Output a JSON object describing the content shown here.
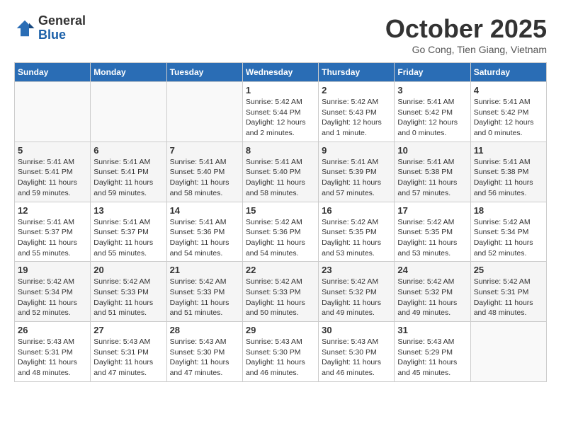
{
  "header": {
    "logo": {
      "general": "General",
      "blue": "Blue"
    },
    "title": "October 2025",
    "location": "Go Cong, Tien Giang, Vietnam"
  },
  "days_of_week": [
    "Sunday",
    "Monday",
    "Tuesday",
    "Wednesday",
    "Thursday",
    "Friday",
    "Saturday"
  ],
  "weeks": [
    [
      {
        "day": "",
        "info": ""
      },
      {
        "day": "",
        "info": ""
      },
      {
        "day": "",
        "info": ""
      },
      {
        "day": "1",
        "info": "Sunrise: 5:42 AM\nSunset: 5:44 PM\nDaylight: 12 hours\nand 2 minutes."
      },
      {
        "day": "2",
        "info": "Sunrise: 5:42 AM\nSunset: 5:43 PM\nDaylight: 12 hours\nand 1 minute."
      },
      {
        "day": "3",
        "info": "Sunrise: 5:41 AM\nSunset: 5:42 PM\nDaylight: 12 hours\nand 0 minutes."
      },
      {
        "day": "4",
        "info": "Sunrise: 5:41 AM\nSunset: 5:42 PM\nDaylight: 12 hours\nand 0 minutes."
      }
    ],
    [
      {
        "day": "5",
        "info": "Sunrise: 5:41 AM\nSunset: 5:41 PM\nDaylight: 11 hours\nand 59 minutes."
      },
      {
        "day": "6",
        "info": "Sunrise: 5:41 AM\nSunset: 5:41 PM\nDaylight: 11 hours\nand 59 minutes."
      },
      {
        "day": "7",
        "info": "Sunrise: 5:41 AM\nSunset: 5:40 PM\nDaylight: 11 hours\nand 58 minutes."
      },
      {
        "day": "8",
        "info": "Sunrise: 5:41 AM\nSunset: 5:40 PM\nDaylight: 11 hours\nand 58 minutes."
      },
      {
        "day": "9",
        "info": "Sunrise: 5:41 AM\nSunset: 5:39 PM\nDaylight: 11 hours\nand 57 minutes."
      },
      {
        "day": "10",
        "info": "Sunrise: 5:41 AM\nSunset: 5:38 PM\nDaylight: 11 hours\nand 57 minutes."
      },
      {
        "day": "11",
        "info": "Sunrise: 5:41 AM\nSunset: 5:38 PM\nDaylight: 11 hours\nand 56 minutes."
      }
    ],
    [
      {
        "day": "12",
        "info": "Sunrise: 5:41 AM\nSunset: 5:37 PM\nDaylight: 11 hours\nand 55 minutes."
      },
      {
        "day": "13",
        "info": "Sunrise: 5:41 AM\nSunset: 5:37 PM\nDaylight: 11 hours\nand 55 minutes."
      },
      {
        "day": "14",
        "info": "Sunrise: 5:41 AM\nSunset: 5:36 PM\nDaylight: 11 hours\nand 54 minutes."
      },
      {
        "day": "15",
        "info": "Sunrise: 5:42 AM\nSunset: 5:36 PM\nDaylight: 11 hours\nand 54 minutes."
      },
      {
        "day": "16",
        "info": "Sunrise: 5:42 AM\nSunset: 5:35 PM\nDaylight: 11 hours\nand 53 minutes."
      },
      {
        "day": "17",
        "info": "Sunrise: 5:42 AM\nSunset: 5:35 PM\nDaylight: 11 hours\nand 53 minutes."
      },
      {
        "day": "18",
        "info": "Sunrise: 5:42 AM\nSunset: 5:34 PM\nDaylight: 11 hours\nand 52 minutes."
      }
    ],
    [
      {
        "day": "19",
        "info": "Sunrise: 5:42 AM\nSunset: 5:34 PM\nDaylight: 11 hours\nand 52 minutes."
      },
      {
        "day": "20",
        "info": "Sunrise: 5:42 AM\nSunset: 5:33 PM\nDaylight: 11 hours\nand 51 minutes."
      },
      {
        "day": "21",
        "info": "Sunrise: 5:42 AM\nSunset: 5:33 PM\nDaylight: 11 hours\nand 51 minutes."
      },
      {
        "day": "22",
        "info": "Sunrise: 5:42 AM\nSunset: 5:33 PM\nDaylight: 11 hours\nand 50 minutes."
      },
      {
        "day": "23",
        "info": "Sunrise: 5:42 AM\nSunset: 5:32 PM\nDaylight: 11 hours\nand 49 minutes."
      },
      {
        "day": "24",
        "info": "Sunrise: 5:42 AM\nSunset: 5:32 PM\nDaylight: 11 hours\nand 49 minutes."
      },
      {
        "day": "25",
        "info": "Sunrise: 5:42 AM\nSunset: 5:31 PM\nDaylight: 11 hours\nand 48 minutes."
      }
    ],
    [
      {
        "day": "26",
        "info": "Sunrise: 5:43 AM\nSunset: 5:31 PM\nDaylight: 11 hours\nand 48 minutes."
      },
      {
        "day": "27",
        "info": "Sunrise: 5:43 AM\nSunset: 5:31 PM\nDaylight: 11 hours\nand 47 minutes."
      },
      {
        "day": "28",
        "info": "Sunrise: 5:43 AM\nSunset: 5:30 PM\nDaylight: 11 hours\nand 47 minutes."
      },
      {
        "day": "29",
        "info": "Sunrise: 5:43 AM\nSunset: 5:30 PM\nDaylight: 11 hours\nand 46 minutes."
      },
      {
        "day": "30",
        "info": "Sunrise: 5:43 AM\nSunset: 5:30 PM\nDaylight: 11 hours\nand 46 minutes."
      },
      {
        "day": "31",
        "info": "Sunrise: 5:43 AM\nSunset: 5:29 PM\nDaylight: 11 hours\nand 45 minutes."
      },
      {
        "day": "",
        "info": ""
      }
    ]
  ]
}
